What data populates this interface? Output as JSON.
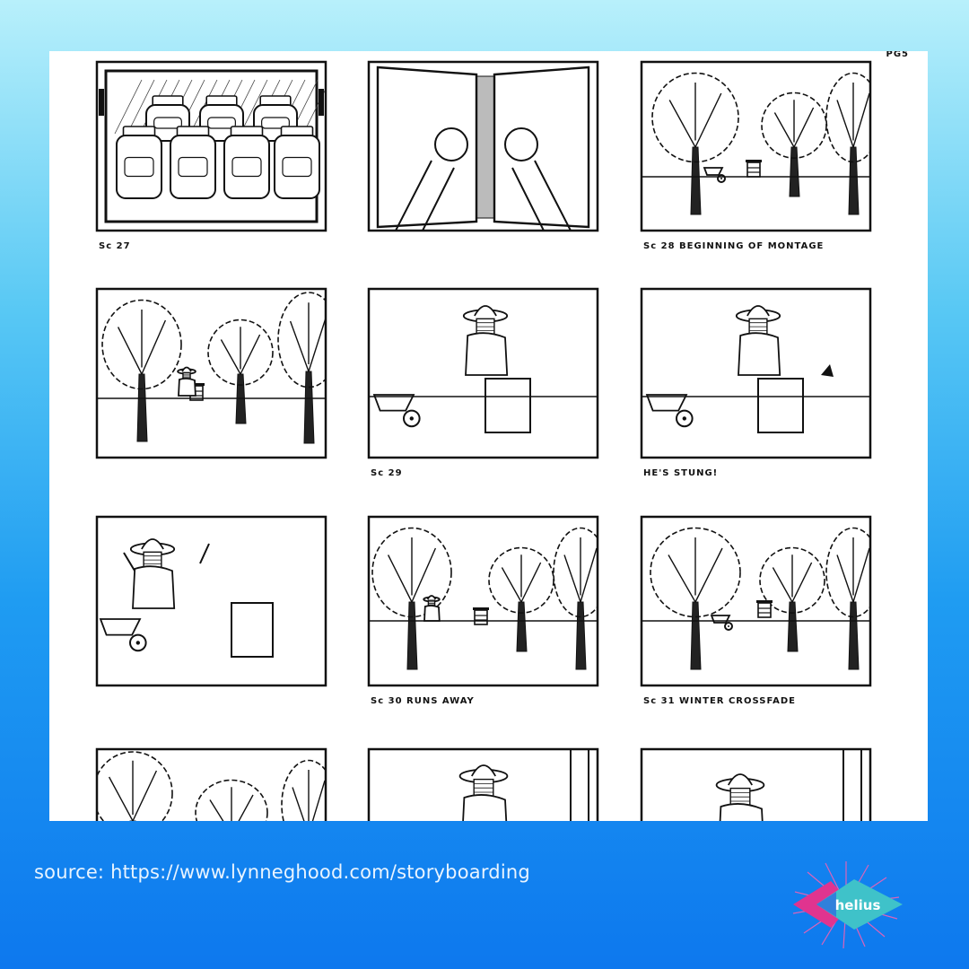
{
  "storyboard": {
    "corner_mark": "PG5",
    "captions": [
      "Sc 27",
      "",
      "Sc 28 BEGINNING OF MONTAGE",
      "",
      "Sc 29",
      "HE'S STUNG!",
      "",
      "Sc 30 RUNS AWAY",
      "Sc 31 WINTER  CROSSFADE",
      "",
      "",
      ""
    ],
    "panels": [
      {
        "scene": "honey jars in cabinet"
      },
      {
        "scene": "hands opening cabinet doors"
      },
      {
        "scene": "orchard with beehive and wheelbarrow"
      },
      {
        "scene": "orchard with beekeeper at hive"
      },
      {
        "scene": "beekeeper opening hive"
      },
      {
        "scene": "beekeeper stung by bee"
      },
      {
        "scene": "beekeeper fleeing bees"
      },
      {
        "scene": "orchard, beekeeper running away"
      },
      {
        "scene": "winter orchard with hive"
      },
      {
        "scene": "bare winter trees"
      },
      {
        "scene": "beekeeper close-up"
      },
      {
        "scene": "beekeeper close-up with bees"
      }
    ]
  },
  "footer": {
    "source_text": "source:  https://www.lynneghood.com/storyboarding"
  },
  "logo": {
    "text": "helius",
    "colors": {
      "magenta": "#e0348f",
      "teal": "#3fc2c9",
      "blue": "#2d6fe0"
    }
  }
}
